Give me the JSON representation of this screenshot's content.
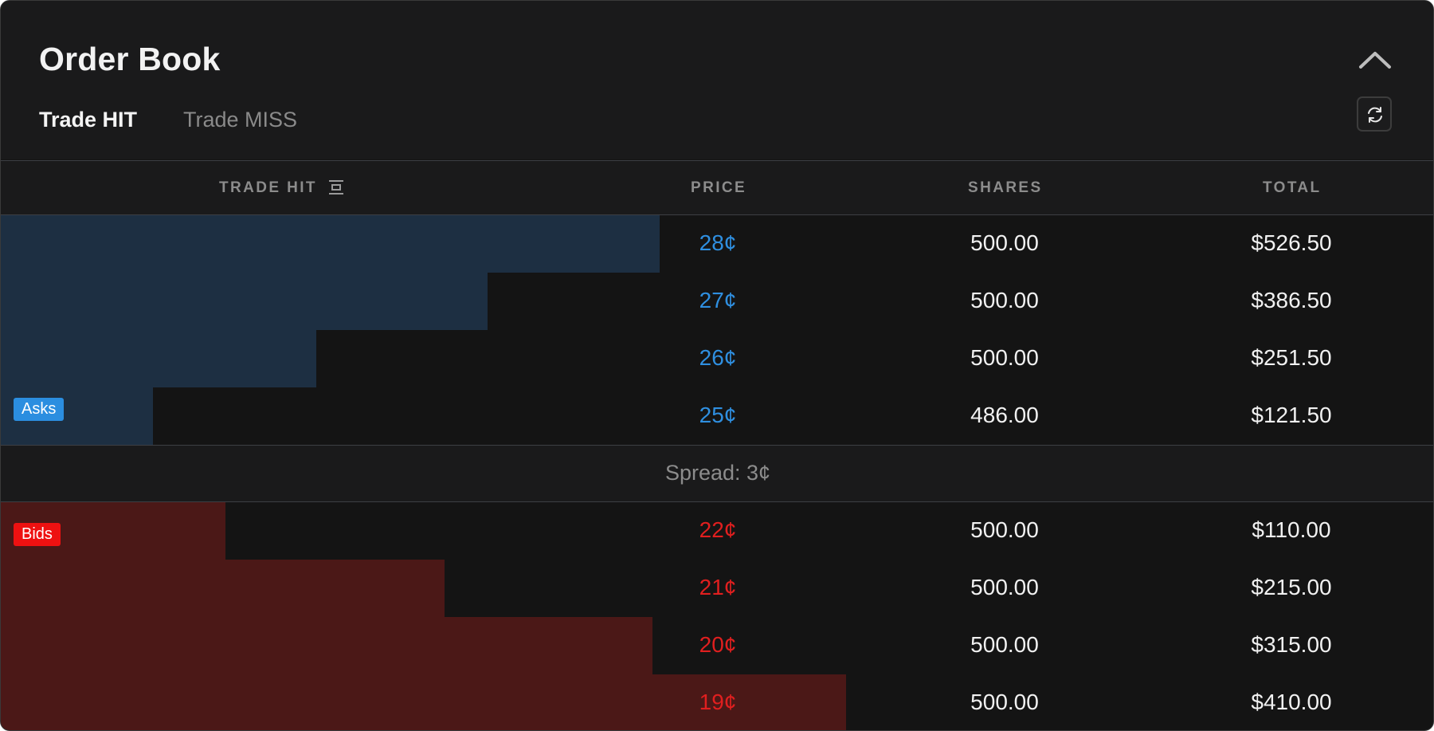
{
  "header": {
    "title": "Order Book",
    "tabs": [
      {
        "label": "Trade HIT",
        "active": true
      },
      {
        "label": "Trade MISS",
        "active": false
      }
    ],
    "icons": {
      "collapse": "chevron-up-icon",
      "refresh": "refresh-icon",
      "sort": "sort-icon"
    }
  },
  "columns": {
    "outcome": "TRADE HIT",
    "price": "PRICE",
    "shares": "SHARES",
    "total": "TOTAL"
  },
  "asks": [
    {
      "price": "28¢",
      "shares": "500.00",
      "total": "$526.50",
      "depth_fraction": 0.46
    },
    {
      "price": "27¢",
      "shares": "500.00",
      "total": "$386.50",
      "depth_fraction": 0.34
    },
    {
      "price": "26¢",
      "shares": "500.00",
      "total": "$251.50",
      "depth_fraction": 0.22
    },
    {
      "price": "25¢",
      "shares": "486.00",
      "total": "$121.50",
      "depth_fraction": 0.106
    }
  ],
  "spread": {
    "label": "Spread: 3¢"
  },
  "bids": [
    {
      "price": "22¢",
      "shares": "500.00",
      "total": "$110.00",
      "depth_fraction": 0.157
    },
    {
      "price": "21¢",
      "shares": "500.00",
      "total": "$215.00",
      "depth_fraction": 0.31
    },
    {
      "price": "20¢",
      "shares": "500.00",
      "total": "$315.00",
      "depth_fraction": 0.455
    },
    {
      "price": "19¢",
      "shares": "500.00",
      "total": "$410.00",
      "depth_fraction": 0.59
    }
  ],
  "badges": {
    "asks": "Asks",
    "bids": "Bids"
  },
  "colors": {
    "ask_accent": "#2f8fe0",
    "bid_accent": "#e01f1f",
    "ask_depth": "#1d2f42",
    "bid_depth": "#4b1817",
    "background": "#141414"
  }
}
